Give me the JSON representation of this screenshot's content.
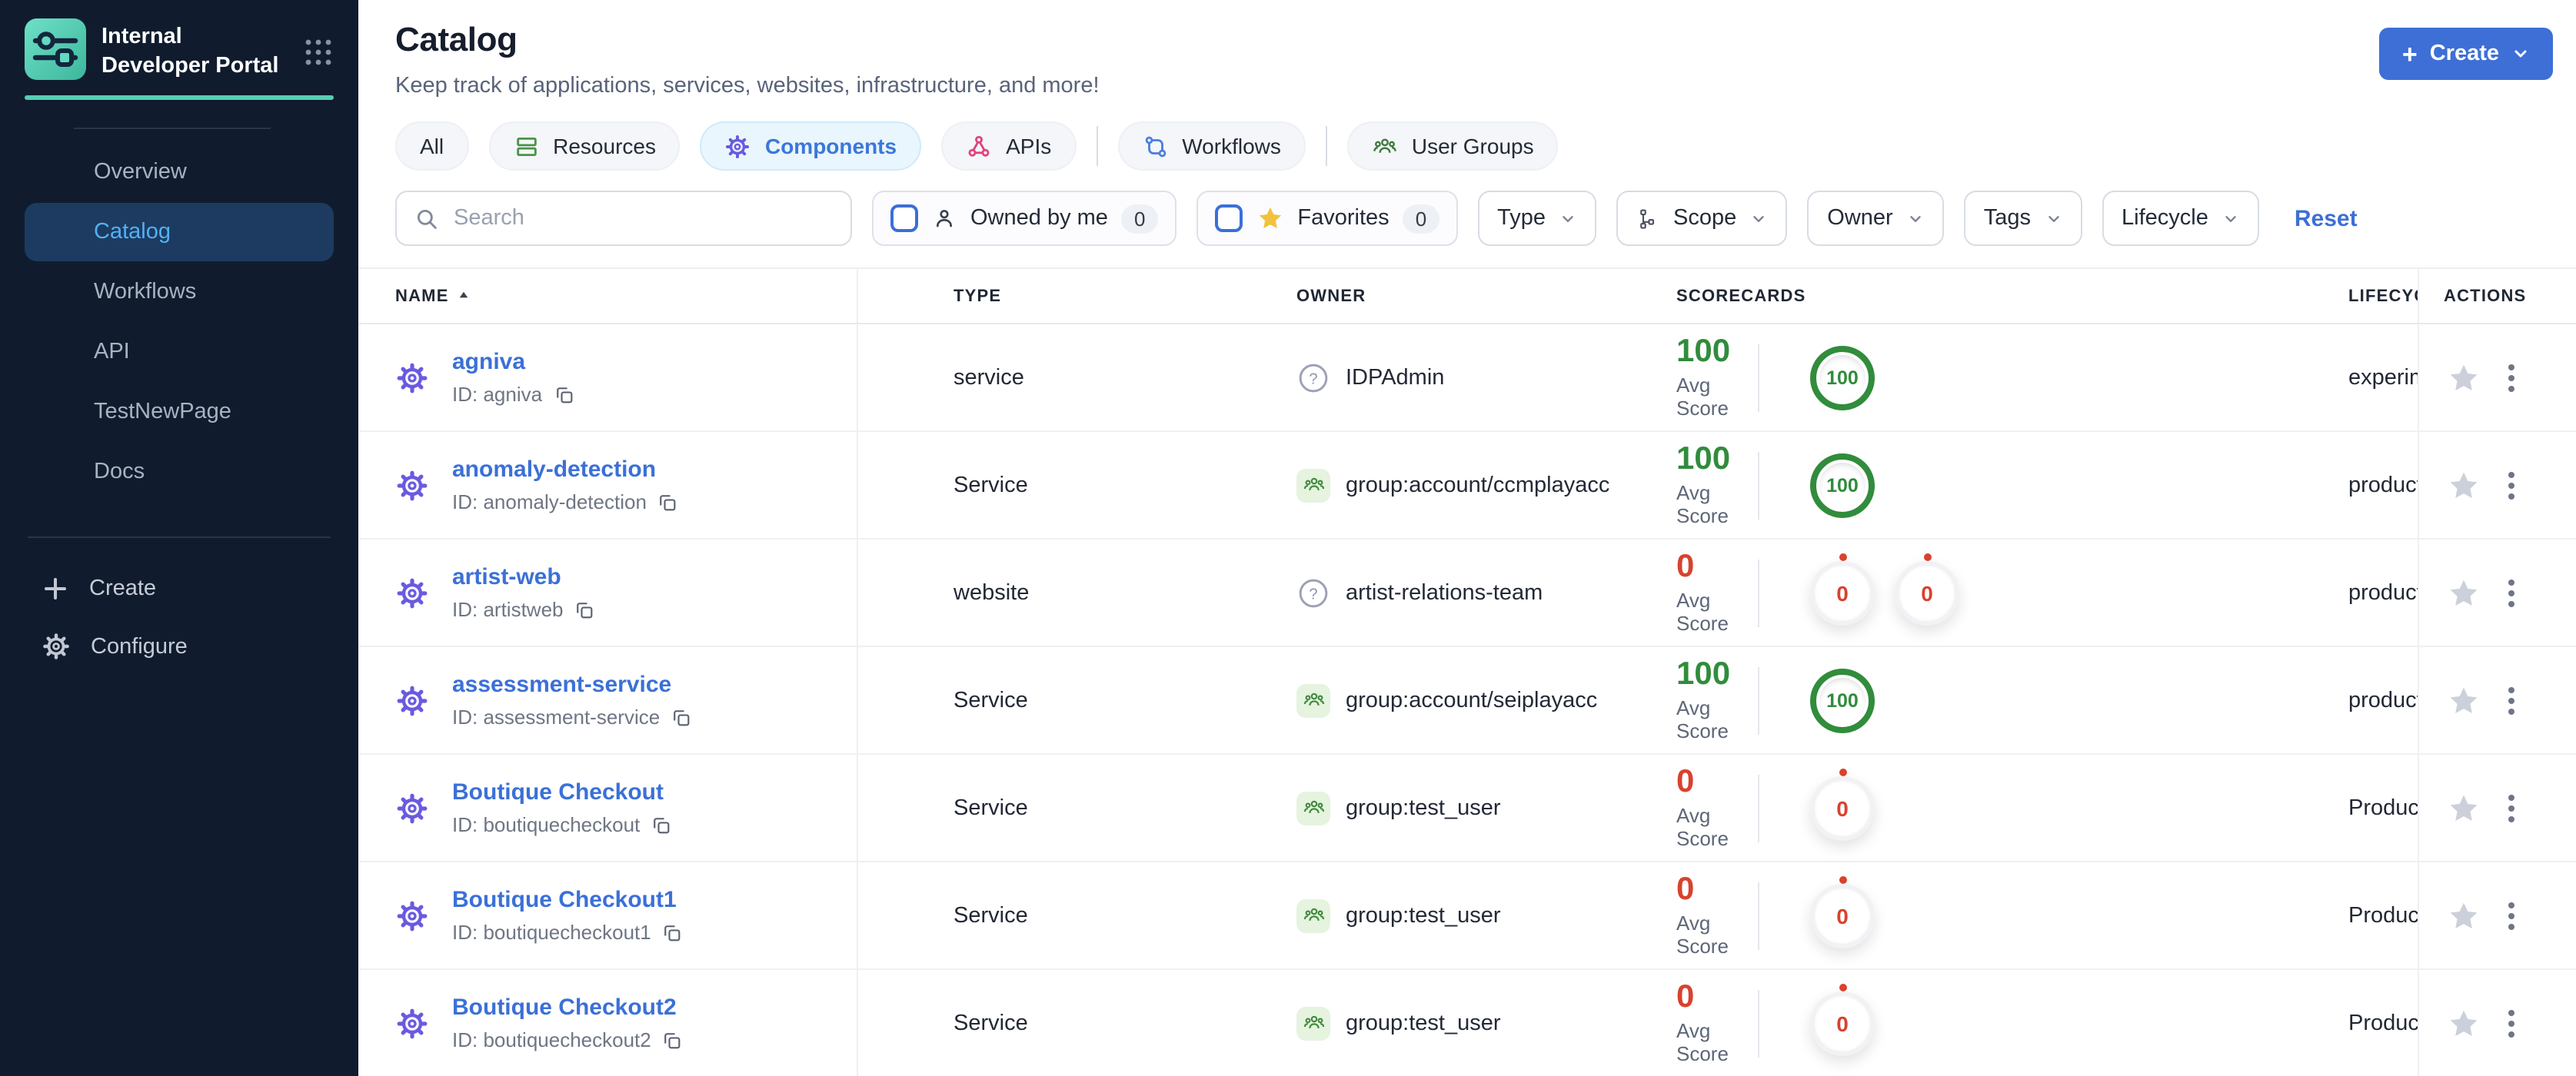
{
  "brand": {
    "title": "Internal Developer Portal"
  },
  "sidebar": {
    "items": [
      {
        "label": "Overview",
        "active": false
      },
      {
        "label": "Catalog",
        "active": true
      },
      {
        "label": "Workflows",
        "active": false
      },
      {
        "label": "API",
        "active": false
      },
      {
        "label": "TestNewPage",
        "active": false
      },
      {
        "label": "Docs",
        "active": false
      }
    ],
    "footer": [
      {
        "label": "Create",
        "icon": "plus-icon"
      },
      {
        "label": "Configure",
        "icon": "gear-icon"
      }
    ]
  },
  "header": {
    "title": "Catalog",
    "subtitle": "Keep track of applications, services, websites, infrastructure, and more!",
    "create_label": "Create"
  },
  "tabs": {
    "items": [
      {
        "label": "All",
        "selected": false
      },
      {
        "label": "Resources",
        "selected": false
      },
      {
        "label": "Components",
        "selected": true
      },
      {
        "label": "APIs",
        "selected": false
      },
      {
        "label": "Workflows",
        "selected": false
      },
      {
        "label": "User Groups",
        "selected": false
      }
    ]
  },
  "filters": {
    "search_placeholder": "Search",
    "owned_by_me": {
      "label": "Owned by me",
      "count": "0"
    },
    "favorites": {
      "label": "Favorites",
      "count": "0"
    },
    "dropdowns": [
      "Type",
      "Scope",
      "Owner",
      "Tags",
      "Lifecycle"
    ],
    "reset_label": "Reset"
  },
  "table": {
    "columns": [
      "NAME",
      "TYPE",
      "OWNER",
      "SCORECARDS",
      "LIFECYCLE",
      "ACTIONS"
    ],
    "avg_score_label": "Avg Score",
    "rows": [
      {
        "name": "agniva",
        "id": "ID: agniva",
        "type": "service",
        "owner": "IDPAdmin",
        "owner_icon": "question",
        "avg_score": "100",
        "score_state": "good",
        "rings": [
          "100"
        ],
        "lifecycle": "experimental"
      },
      {
        "name": "anomaly-detection",
        "id": "ID: anomaly-detection",
        "type": "Service",
        "owner": "group:account/ccmplayacc",
        "owner_icon": "group",
        "avg_score": "100",
        "score_state": "good",
        "rings": [
          "100"
        ],
        "lifecycle": "production"
      },
      {
        "name": "artist-web",
        "id": "ID: artistweb",
        "type": "website",
        "owner": "artist-relations-team",
        "owner_icon": "question",
        "avg_score": "0",
        "score_state": "bad",
        "rings": [
          "0",
          "0"
        ],
        "lifecycle": "production"
      },
      {
        "name": "assessment-service",
        "id": "ID: assessment-service",
        "type": "Service",
        "owner": "group:account/seiplayacc",
        "owner_icon": "group",
        "avg_score": "100",
        "score_state": "good",
        "rings": [
          "100"
        ],
        "lifecycle": "production"
      },
      {
        "name": "Boutique Checkout",
        "id": "ID: boutiquecheckout",
        "type": "Service",
        "owner": "group:test_user",
        "owner_icon": "group",
        "avg_score": "0",
        "score_state": "bad",
        "rings": [
          "0"
        ],
        "lifecycle": "Production"
      },
      {
        "name": "Boutique Checkout1",
        "id": "ID: boutiquecheckout1",
        "type": "Service",
        "owner": "group:test_user",
        "owner_icon": "group",
        "avg_score": "0",
        "score_state": "bad",
        "rings": [
          "0"
        ],
        "lifecycle": "Production"
      },
      {
        "name": "Boutique Checkout2",
        "id": "ID: boutiquecheckout2",
        "type": "Service",
        "owner": "group:test_user",
        "owner_icon": "group",
        "avg_score": "0",
        "score_state": "bad",
        "rings": [
          "0"
        ],
        "lifecycle": "Production"
      }
    ]
  },
  "colors": {
    "accent_blue": "#3d6fd6",
    "sidebar_navy": "#101c2e",
    "teal": "#57cdb4",
    "score_green": "#318c3c",
    "score_red": "#d8422e",
    "icon_purple": "#6a5ae0",
    "icon_pink": "#e0447d",
    "icon_green": "#3e8a3c"
  }
}
